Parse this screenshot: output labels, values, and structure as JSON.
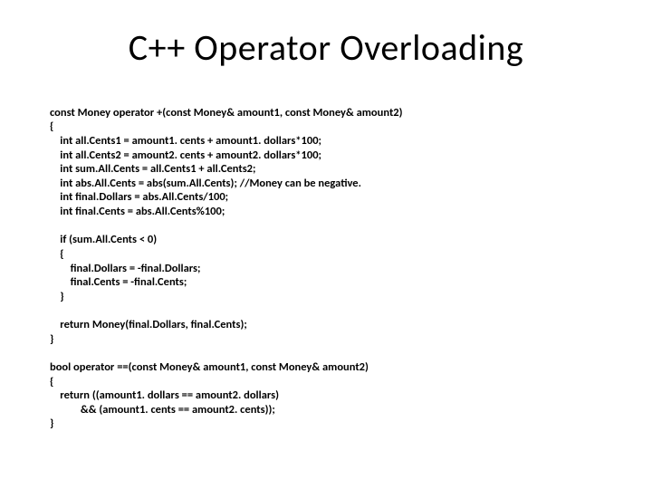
{
  "title": "C++ Operator Overloading",
  "code": {
    "l1": "const Money operator +(const Money& amount1, const Money& amount2)",
    "l2": "{",
    "l3": "    int all.Cents1 = amount1. cents + amount1. dollars*100;",
    "l4": "    int all.Cents2 = amount2. cents + amount2. dollars*100;",
    "l5": "    int sum.All.Cents = all.Cents1 + all.Cents2;",
    "l6": "    int abs.All.Cents = abs(sum.All.Cents); //Money can be negative.",
    "l7": "    int final.Dollars = abs.All.Cents/100;",
    "l8": "    int final.Cents = abs.All.Cents%100;",
    "l9": "",
    "l10": "    if (sum.All.Cents < 0)",
    "l11": "    {",
    "l12": "        final.Dollars = -final.Dollars;",
    "l13": "        final.Cents = -final.Cents;",
    "l14": "    }",
    "l15": "",
    "l16": "    return Money(final.Dollars, final.Cents);",
    "l17": "}",
    "l18": "",
    "l19": "bool operator ==(const Money& amount1, const Money& amount2)",
    "l20": "{",
    "l21": "    return ((amount1. dollars == amount2. dollars)",
    "l22": "            && (amount1. cents == amount2. cents));",
    "l23": "}"
  }
}
